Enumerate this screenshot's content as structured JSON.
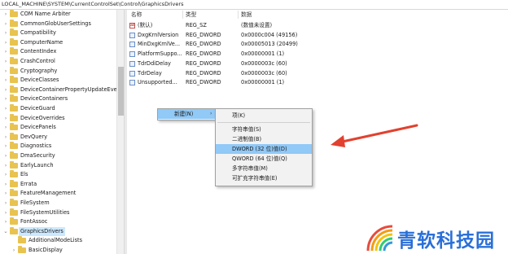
{
  "address_bar": {
    "path": "LOCAL_MACHINE\\SYSTEM\\CurrentControlSet\\Control\\GraphicsDrivers"
  },
  "tree": {
    "items": [
      {
        "label": "COM Name Arbiter",
        "expander": "›"
      },
      {
        "label": "CommonGlobUserSettings",
        "expander": "›"
      },
      {
        "label": "Compatibility",
        "expander": "›"
      },
      {
        "label": "ComputerName",
        "expander": "›"
      },
      {
        "label": "ContentIndex",
        "expander": "›"
      },
      {
        "label": "CrashControl",
        "expander": "›"
      },
      {
        "label": "Cryptography",
        "expander": "›"
      },
      {
        "label": "DeviceClasses",
        "expander": "›"
      },
      {
        "label": "DeviceContainerPropertyUpdateEve",
        "expander": "›"
      },
      {
        "label": "DeviceContainers",
        "expander": "›"
      },
      {
        "label": "DeviceGuard",
        "expander": "›"
      },
      {
        "label": "DeviceOverrides",
        "expander": "›"
      },
      {
        "label": "DevicePanels",
        "expander": "›"
      },
      {
        "label": "DevQuery",
        "expander": "›"
      },
      {
        "label": "Diagnostics",
        "expander": "›"
      },
      {
        "label": "DmaSecurity",
        "expander": "›"
      },
      {
        "label": "EarlyLaunch",
        "expander": "›"
      },
      {
        "label": "Els",
        "expander": "›"
      },
      {
        "label": "Errata",
        "expander": "›"
      },
      {
        "label": "FeatureManagement",
        "expander": "›"
      },
      {
        "label": "FileSystem",
        "expander": "›"
      },
      {
        "label": "FileSystemUtilities",
        "expander": "›"
      },
      {
        "label": "FontAssoc",
        "expander": "›"
      },
      {
        "label": "GraphicsDrivers",
        "expander": "⌄",
        "selected": true
      },
      {
        "label": "AdditionalModeLists",
        "expander": "",
        "child": true
      },
      {
        "label": "BasicDisplay",
        "expander": "›",
        "child": true
      }
    ]
  },
  "list": {
    "columns": [
      "名称",
      "类型",
      "数据"
    ],
    "rows": [
      {
        "name": "(默认)",
        "type": "REG_SZ",
        "data": "(数值未设置)",
        "icon": "string-value-icon"
      },
      {
        "name": "DxgKrnlVersion",
        "type": "REG_DWORD",
        "data": "0x0000c004 (49156)",
        "icon": "dword-value-icon"
      },
      {
        "name": "MinDxgKrnlVe...",
        "type": "REG_DWORD",
        "data": "0x00005013 (20499)",
        "icon": "dword-value-icon"
      },
      {
        "name": "PlatformSuppo...",
        "type": "REG_DWORD",
        "data": "0x00000001 (1)",
        "icon": "dword-value-icon"
      },
      {
        "name": "TdrDdiDelay",
        "type": "REG_DWORD",
        "data": "0x0000003c (60)",
        "icon": "dword-value-icon"
      },
      {
        "name": "TdrDelay",
        "type": "REG_DWORD",
        "data": "0x0000003c (60)",
        "icon": "dword-value-icon"
      },
      {
        "name": "Unsupported...",
        "type": "REG_DWORD",
        "data": "0x00000001 (1)",
        "icon": "dword-value-icon"
      }
    ]
  },
  "context_menu": {
    "new_label": "新建(N)",
    "submenu_arrow": "›"
  },
  "submenu": {
    "items": [
      {
        "label": "项(K)"
      },
      {
        "label": "字符串值(S)"
      },
      {
        "label": "二进制值(B)"
      },
      {
        "label": "DWORD (32 位)值(D)",
        "highlighted": true
      },
      {
        "label": "QWORD (64 位)值(Q)"
      },
      {
        "label": "多字符串值(M)"
      },
      {
        "label": "可扩充字符串值(E)"
      }
    ]
  },
  "annotation": {
    "color": "#e2412f",
    "shape": "pointing-arrow"
  },
  "watermark": {
    "text": "青软科技园",
    "brand_color": "#2a6fd8"
  }
}
